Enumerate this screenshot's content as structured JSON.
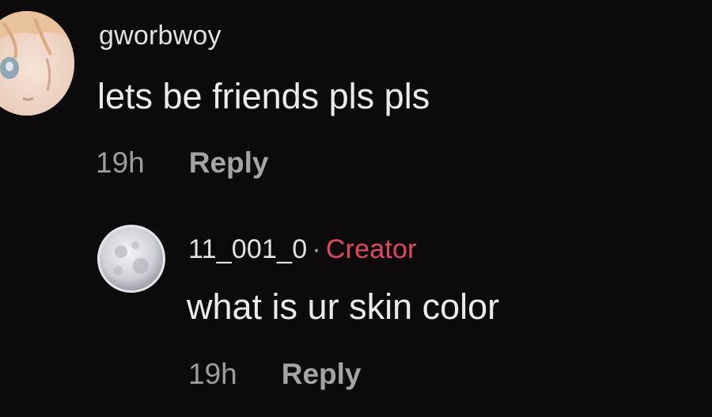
{
  "comments": [
    {
      "username": "gworbwoy",
      "text": "lets be friends pls pls",
      "time": "19h",
      "reply_label": "Reply",
      "avatar_icon": "anime-girl-avatar-icon"
    },
    {
      "username": "11_001_0",
      "separator": "·",
      "badge": "Creator",
      "text": "what is ur skin color",
      "time": "19h",
      "reply_label": "Reply",
      "avatar_icon": "moon-avatar-icon"
    }
  ],
  "colors": {
    "background": "#0d0a0c",
    "creator_badge": "#e0485e",
    "secondary_text": "#9f9c9e"
  }
}
